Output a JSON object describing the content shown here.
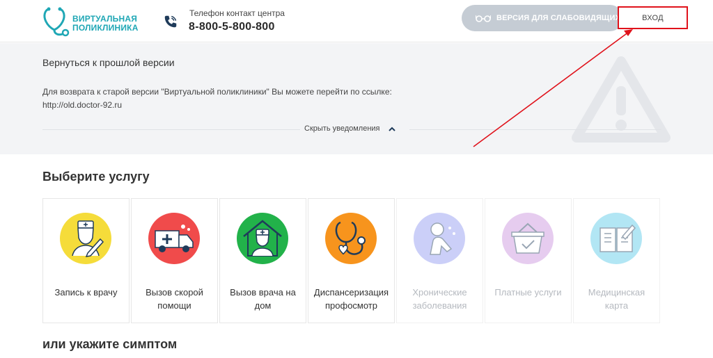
{
  "header": {
    "logo_line1": "ВИРТУАЛЬНАЯ",
    "logo_line2": "ПОЛИКЛИНИКА",
    "phone_label": "Телефон контакт центра",
    "phone_number": "8-800-5-800-800",
    "vision_label": "ВЕРСИЯ ДЛЯ СЛАБОВИДЯЩИХ",
    "login_label": "ВХОД"
  },
  "notice": {
    "title": "Вернуться к прошлой версии",
    "text": "Для возврата к старой версии \"Виртуальной поликлиники\" Вы можете перейти по ссылке:",
    "link": "http://old.doctor-92.ru",
    "hide_label": "Скрыть уведомления"
  },
  "services": {
    "title": "Выберите услугу",
    "items": [
      {
        "label": "Запись к врачу",
        "color": "#f5dc3a",
        "icon": "doctor-pen-icon",
        "active": true
      },
      {
        "label": "Вызов скорой помощи",
        "color": "#f04b4b",
        "icon": "ambulance-icon",
        "active": true
      },
      {
        "label": "Вызов врача на дом",
        "color": "#22b24a",
        "icon": "doctor-house-icon",
        "active": true
      },
      {
        "label": "Диспансеризация профосмотр",
        "color": "#f7941d",
        "icon": "stethoscope-icon",
        "active": true
      },
      {
        "label": "Хронические заболевания",
        "color": "#8e97f0",
        "icon": "chronic-illness-icon",
        "active": false
      },
      {
        "label": "Платные услуги",
        "color": "#c98fdd",
        "icon": "basket-icon",
        "active": false
      },
      {
        "label": "Медицинская карта",
        "color": "#56c8e8",
        "icon": "medical-card-icon",
        "active": false
      }
    ]
  },
  "symptom_title": "или укажите симптом",
  "colors": {
    "brand": "#1fa7b5",
    "annotation": "#e0121b",
    "vision_button": "#c5ccd4"
  }
}
